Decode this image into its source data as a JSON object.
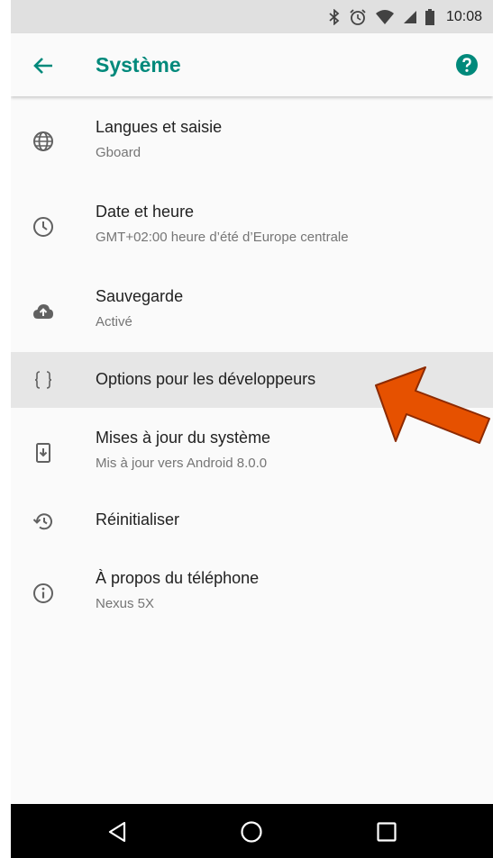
{
  "status_bar": {
    "time": "10:08",
    "icons": [
      "bluetooth-icon",
      "alarm-icon",
      "wifi-icon",
      "signal-icon",
      "battery-icon"
    ]
  },
  "app_bar": {
    "title": "Système",
    "back_icon": "arrow-back-icon",
    "help_icon": "help-icon"
  },
  "items": [
    {
      "title": "Langues et saisie",
      "subtitle": "Gboard",
      "icon": "globe-icon"
    },
    {
      "title": "Date et heure",
      "subtitle": "GMT+02:00 heure d’été d’Europe centrale",
      "icon": "clock-icon"
    },
    {
      "title": "Sauvegarde",
      "subtitle": "Activé",
      "icon": "cloud-upload-icon"
    },
    {
      "title": "Options pour les développeurs",
      "subtitle": "",
      "icon": "braces-icon"
    },
    {
      "title": "Mises à jour du système",
      "subtitle": "Mis à jour vers Android 8.0.0",
      "icon": "system-update-icon"
    },
    {
      "title": "Réinitialiser",
      "subtitle": "",
      "icon": "restore-icon"
    },
    {
      "title": "À propos du téléphone",
      "subtitle": "Nexus 5X",
      "icon": "info-icon"
    }
  ],
  "nav_bar": {
    "buttons": [
      "back-triangle-icon",
      "home-circle-icon",
      "recents-square-icon"
    ]
  },
  "colors": {
    "accent": "#00897b",
    "annotation_arrow": "#e65100"
  }
}
